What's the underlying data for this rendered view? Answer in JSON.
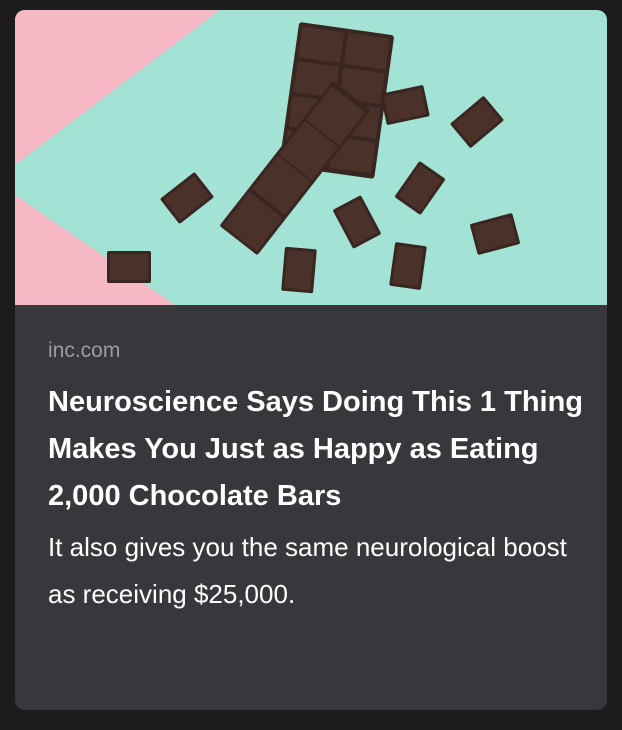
{
  "link_preview": {
    "image": {
      "icon": "chocolate-photo",
      "colors": {
        "pink": "#f5b8c4",
        "mint": "#a3e3d6",
        "chocolate": "#3d2822"
      }
    },
    "domain": "inc.com",
    "headline": "Neuroscience Says Doing This 1 Thing Makes You Just as Happy as Eating 2,000 Chocolate Bars",
    "summary": "It also gives you the same neurological boost as receiving $25,000."
  },
  "colors": {
    "background": "#1c1c1e",
    "card": "#38383c",
    "domain_text": "#9b9ba1",
    "text": "#ffffff"
  }
}
